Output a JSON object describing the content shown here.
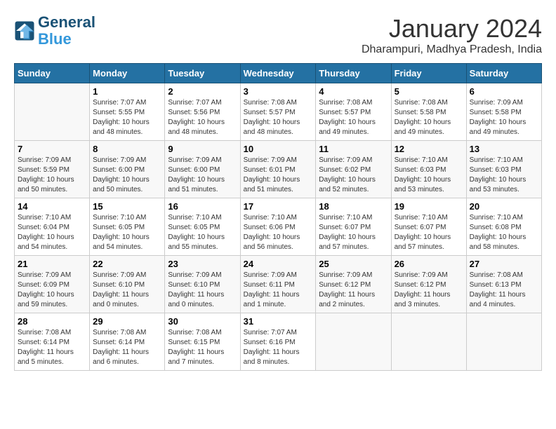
{
  "header": {
    "logo_line1": "General",
    "logo_line2": "Blue",
    "month_title": "January 2024",
    "location": "Dharampuri, Madhya Pradesh, India"
  },
  "weekdays": [
    "Sunday",
    "Monday",
    "Tuesday",
    "Wednesday",
    "Thursday",
    "Friday",
    "Saturday"
  ],
  "weeks": [
    [
      {
        "day": "",
        "sunrise": "",
        "sunset": "",
        "daylight": ""
      },
      {
        "day": "1",
        "sunrise": "7:07 AM",
        "sunset": "5:55 PM",
        "daylight": "10 hours and 48 minutes."
      },
      {
        "day": "2",
        "sunrise": "7:07 AM",
        "sunset": "5:56 PM",
        "daylight": "10 hours and 48 minutes."
      },
      {
        "day": "3",
        "sunrise": "7:08 AM",
        "sunset": "5:57 PM",
        "daylight": "10 hours and 48 minutes."
      },
      {
        "day": "4",
        "sunrise": "7:08 AM",
        "sunset": "5:57 PM",
        "daylight": "10 hours and 49 minutes."
      },
      {
        "day": "5",
        "sunrise": "7:08 AM",
        "sunset": "5:58 PM",
        "daylight": "10 hours and 49 minutes."
      },
      {
        "day": "6",
        "sunrise": "7:09 AM",
        "sunset": "5:58 PM",
        "daylight": "10 hours and 49 minutes."
      }
    ],
    [
      {
        "day": "7",
        "sunrise": "7:09 AM",
        "sunset": "5:59 PM",
        "daylight": "10 hours and 50 minutes."
      },
      {
        "day": "8",
        "sunrise": "7:09 AM",
        "sunset": "6:00 PM",
        "daylight": "10 hours and 50 minutes."
      },
      {
        "day": "9",
        "sunrise": "7:09 AM",
        "sunset": "6:00 PM",
        "daylight": "10 hours and 51 minutes."
      },
      {
        "day": "10",
        "sunrise": "7:09 AM",
        "sunset": "6:01 PM",
        "daylight": "10 hours and 51 minutes."
      },
      {
        "day": "11",
        "sunrise": "7:09 AM",
        "sunset": "6:02 PM",
        "daylight": "10 hours and 52 minutes."
      },
      {
        "day": "12",
        "sunrise": "7:10 AM",
        "sunset": "6:03 PM",
        "daylight": "10 hours and 53 minutes."
      },
      {
        "day": "13",
        "sunrise": "7:10 AM",
        "sunset": "6:03 PM",
        "daylight": "10 hours and 53 minutes."
      }
    ],
    [
      {
        "day": "14",
        "sunrise": "7:10 AM",
        "sunset": "6:04 PM",
        "daylight": "10 hours and 54 minutes."
      },
      {
        "day": "15",
        "sunrise": "7:10 AM",
        "sunset": "6:05 PM",
        "daylight": "10 hours and 54 minutes."
      },
      {
        "day": "16",
        "sunrise": "7:10 AM",
        "sunset": "6:05 PM",
        "daylight": "10 hours and 55 minutes."
      },
      {
        "day": "17",
        "sunrise": "7:10 AM",
        "sunset": "6:06 PM",
        "daylight": "10 hours and 56 minutes."
      },
      {
        "day": "18",
        "sunrise": "7:10 AM",
        "sunset": "6:07 PM",
        "daylight": "10 hours and 57 minutes."
      },
      {
        "day": "19",
        "sunrise": "7:10 AM",
        "sunset": "6:07 PM",
        "daylight": "10 hours and 57 minutes."
      },
      {
        "day": "20",
        "sunrise": "7:10 AM",
        "sunset": "6:08 PM",
        "daylight": "10 hours and 58 minutes."
      }
    ],
    [
      {
        "day": "21",
        "sunrise": "7:09 AM",
        "sunset": "6:09 PM",
        "daylight": "10 hours and 59 minutes."
      },
      {
        "day": "22",
        "sunrise": "7:09 AM",
        "sunset": "6:10 PM",
        "daylight": "11 hours and 0 minutes."
      },
      {
        "day": "23",
        "sunrise": "7:09 AM",
        "sunset": "6:10 PM",
        "daylight": "11 hours and 0 minutes."
      },
      {
        "day": "24",
        "sunrise": "7:09 AM",
        "sunset": "6:11 PM",
        "daylight": "11 hours and 1 minute."
      },
      {
        "day": "25",
        "sunrise": "7:09 AM",
        "sunset": "6:12 PM",
        "daylight": "11 hours and 2 minutes."
      },
      {
        "day": "26",
        "sunrise": "7:09 AM",
        "sunset": "6:12 PM",
        "daylight": "11 hours and 3 minutes."
      },
      {
        "day": "27",
        "sunrise": "7:08 AM",
        "sunset": "6:13 PM",
        "daylight": "11 hours and 4 minutes."
      }
    ],
    [
      {
        "day": "28",
        "sunrise": "7:08 AM",
        "sunset": "6:14 PM",
        "daylight": "11 hours and 5 minutes."
      },
      {
        "day": "29",
        "sunrise": "7:08 AM",
        "sunset": "6:14 PM",
        "daylight": "11 hours and 6 minutes."
      },
      {
        "day": "30",
        "sunrise": "7:08 AM",
        "sunset": "6:15 PM",
        "daylight": "11 hours and 7 minutes."
      },
      {
        "day": "31",
        "sunrise": "7:07 AM",
        "sunset": "6:16 PM",
        "daylight": "11 hours and 8 minutes."
      },
      {
        "day": "",
        "sunrise": "",
        "sunset": "",
        "daylight": ""
      },
      {
        "day": "",
        "sunrise": "",
        "sunset": "",
        "daylight": ""
      },
      {
        "day": "",
        "sunrise": "",
        "sunset": "",
        "daylight": ""
      }
    ]
  ],
  "labels": {
    "sunrise_prefix": "Sunrise: ",
    "sunset_prefix": "Sunset: ",
    "daylight_prefix": "Daylight: "
  }
}
